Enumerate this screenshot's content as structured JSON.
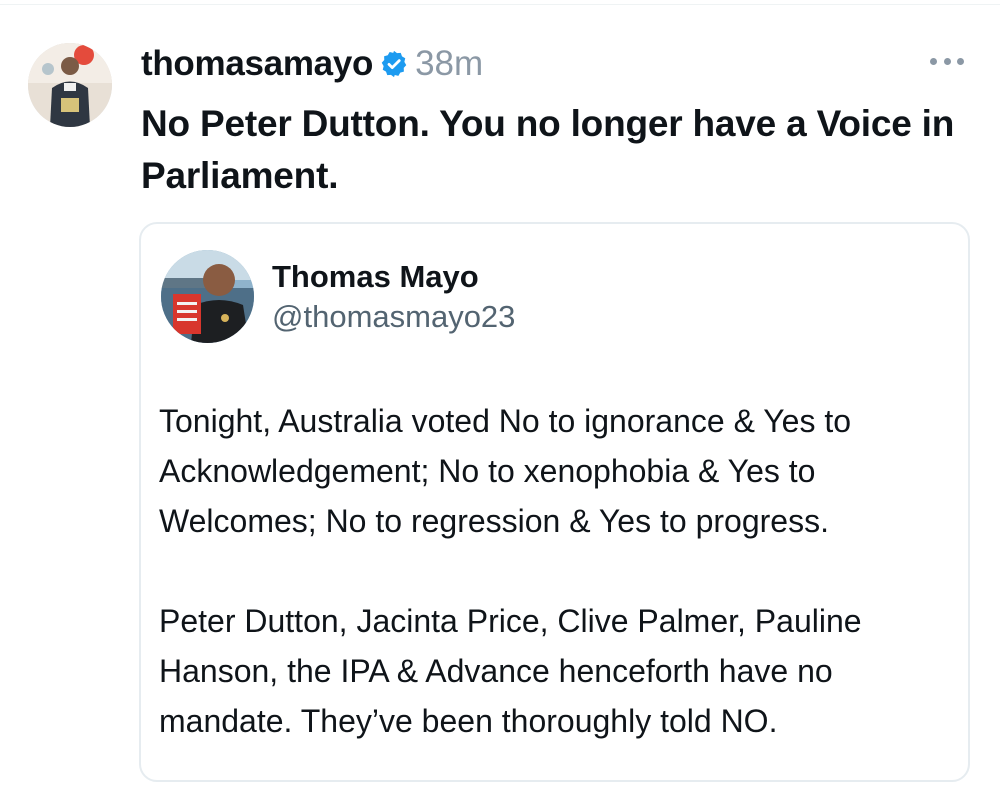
{
  "post": {
    "author": {
      "username": "thomasamayo",
      "verified": true,
      "avatar_icon": "profile-photo"
    },
    "timestamp": "38m",
    "more_icon": "ellipsis-icon",
    "text": "No Peter Dutton. You no longer have a Voice in Parliament."
  },
  "quoted_post": {
    "display_name": "Thomas Mayo",
    "handle": "@thomasmayo23",
    "avatar_icon": "profile-photo-with-book",
    "paragraphs": [
      "Tonight, Australia voted No to ignorance & Yes to Acknowledgement; No to xenophobia & Yes to Welcomes; No to regression & Yes to progress.",
      "Peter Dutton, Jacinta Price, Clive Palmer, Pauline Hanson, the IPA & Advance henceforth have no mandate. They’ve been thoroughly told NO."
    ]
  },
  "colors": {
    "verified_badge": "#1d9bf0",
    "secondary_text": "#536471",
    "muted_text": "#8b98a5",
    "border": "#e6ecf0"
  }
}
